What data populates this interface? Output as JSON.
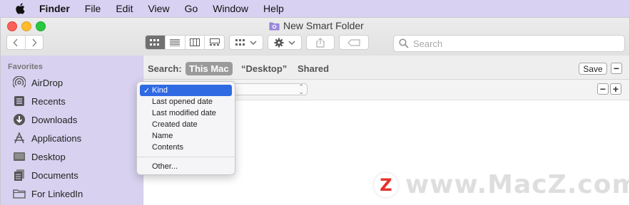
{
  "menubar": {
    "app_name": "Finder",
    "items": [
      "File",
      "Edit",
      "View",
      "Go",
      "Window",
      "Help"
    ]
  },
  "window": {
    "title": "New Smart Folder",
    "search_placeholder": "Search"
  },
  "sidebar": {
    "section_title": "Favorites",
    "items": [
      {
        "label": "AirDrop",
        "icon": "airdrop-icon"
      },
      {
        "label": "Recents",
        "icon": "recents-icon"
      },
      {
        "label": "Downloads",
        "icon": "downloads-icon"
      },
      {
        "label": "Applications",
        "icon": "applications-icon"
      },
      {
        "label": "Desktop",
        "icon": "desktop-icon"
      },
      {
        "label": "Documents",
        "icon": "documents-icon"
      },
      {
        "label": "For LinkedIn",
        "icon": "folder-icon"
      }
    ]
  },
  "scopebar": {
    "label": "Search:",
    "scopes": [
      "This Mac",
      "“Desktop”",
      "Shared"
    ],
    "selected_scope": "This Mac",
    "save_label": "Save",
    "minus_label": "−",
    "plus_label": "+"
  },
  "criteria_menu": {
    "items": [
      "Kind",
      "Last opened date",
      "Last modified date",
      "Created date",
      "Name",
      "Contents"
    ],
    "selected": "Kind",
    "other_label": "Other...",
    "check": "✓"
  },
  "watermark": {
    "logo_letter": "Z",
    "text": "www.MacZ.com"
  },
  "colors": {
    "sidebar_bg": "#d8d2f0",
    "menubar_bg": "#d9d1f2",
    "selection": "#2f6ae3"
  }
}
